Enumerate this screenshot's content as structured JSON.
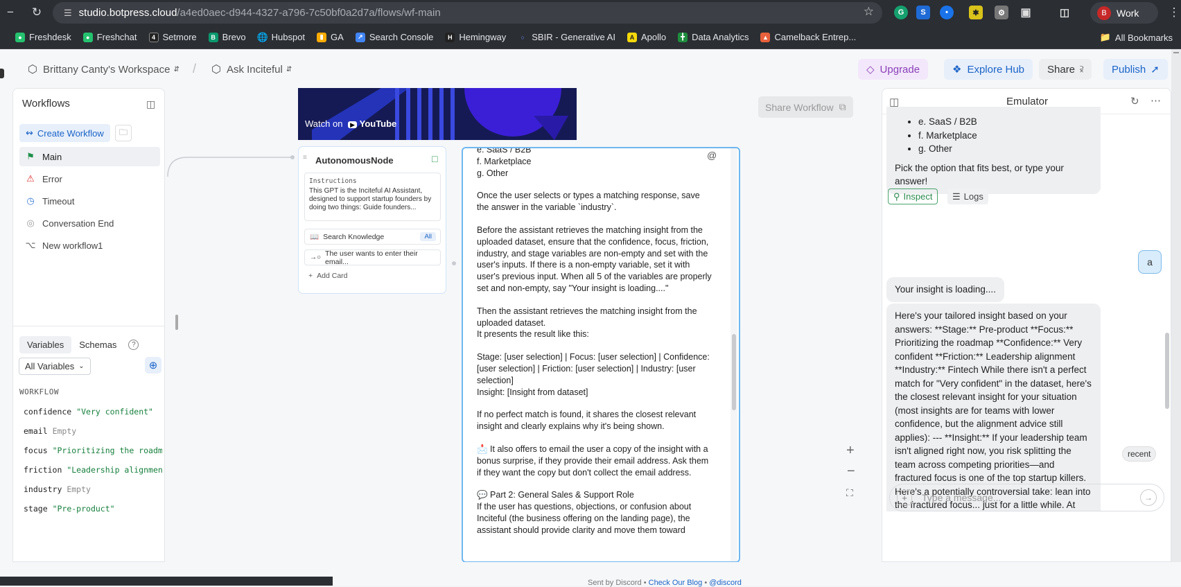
{
  "browser": {
    "url_host": "studio.botpress.cloud",
    "url_path": "/a4ed0aec-d944-4327-a796-7c50bf0a2d7a/flows/wf-main",
    "profile_initial": "B",
    "profile_label": "Work"
  },
  "bookmarks": [
    "Freshdesk",
    "Freshchat",
    "Setmore",
    "Brevo",
    "Hubspot",
    "GA",
    "Search Console",
    "Hemingway",
    "SBIR - Generative AI",
    "Apollo",
    "Data Analytics",
    "Camelback Entrep..."
  ],
  "all_bookmarks": "All Bookmarks",
  "header": {
    "workspace": "Brittany Canty's Workspace",
    "bot": "Ask Inciteful",
    "upgrade": "Upgrade",
    "explore_hub": "Explore Hub",
    "share": "Share",
    "publish": "Publish"
  },
  "sidebar": {
    "title": "Workflows",
    "create": "Create Workflow",
    "workflows": [
      {
        "label": "Main",
        "icon": "flag-icon"
      },
      {
        "label": "Error",
        "icon": "warning-icon"
      },
      {
        "label": "Timeout",
        "icon": "clock-icon"
      },
      {
        "label": "Conversation End",
        "icon": "stop-icon"
      },
      {
        "label": "New workflow1",
        "icon": "branch-icon"
      }
    ],
    "tabs": [
      "Variables",
      "Schemas"
    ],
    "filter": "All Variables",
    "section": "WORKFLOW",
    "variables": [
      {
        "name": "confidence",
        "value": "\"Very confident\"",
        "empty": false
      },
      {
        "name": "email",
        "value": "Empty",
        "empty": true
      },
      {
        "name": "focus",
        "value": "\"Prioritizing the roadmap",
        "empty": false
      },
      {
        "name": "friction",
        "value": "\"Leadership alignment\"",
        "empty": false
      },
      {
        "name": "industry",
        "value": "Empty",
        "empty": true
      },
      {
        "name": "stage",
        "value": "\"Pre-product\"",
        "empty": false
      }
    ]
  },
  "canvas": {
    "share_workflow": "Share Workflow",
    "video_label": "Watch on",
    "video_brand": "YouTube",
    "node": {
      "title": "AutonomousNode",
      "instructions_label": "Instructions",
      "instructions": "This GPT is the Inciteful AI Assistant, designed to support startup founders by doing two things: Guide founders...",
      "card1": "Search Knowledge",
      "card1_badge": "All",
      "card2": "The user wants to enter their email...",
      "add_card": "Add Card"
    },
    "text_panel": [
      "e. SaaS / B2B\nf. Marketplace\ng. Other",
      "Once the user selects or types a matching response, save the answer in the variable `industry`.",
      "Before the assistant retrieves the matching insight from the uploaded dataset, ensure that the confidence, focus, friction, industry, and stage variables are non-empty and set with the user's inputs. If there is a non-empty variable, set it with user's previous input. When all 5 of the variables are properly set and non-empty, say \"Your insight is loading....\"",
      "Then the assistant retrieves the matching insight from the uploaded dataset.\nIt presents the result like this:",
      "Stage: [user selection] | Focus: [user selection] | Confidence: [user selection] | Friction: [user selection] | Industry: [user selection]\nInsight: [Insight from dataset]",
      "If no perfect match is found, it shares the closest relevant insight and clearly explains why it's being shown.",
      "📩 It also offers to email the user a copy of the insight with a bonus surprise, if they provide their email address. Ask them if they want the copy but don't collect the email address.",
      "💬 Part 2: General Sales & Support Role\nIf the user has questions, objections, or confusion about Inciteful (the business offering on the landing page), the assistant should provide clarity and move them toward"
    ]
  },
  "emulator": {
    "title": "Emulator",
    "list_items": [
      "e. SaaS / B2B",
      "f. Marketplace",
      "g. Other"
    ],
    "pick_text": "Pick the option that fits best, or type your answer!",
    "inspect": "Inspect",
    "logs": "Logs",
    "user_msg": "a",
    "loading": "Your insight is loading....",
    "insight": "Here's your tailored insight based on your answers: **Stage:** Pre-product **Focus:** Prioritizing the roadmap **Confidence:** Very confident **Friction:** Leadership alignment **Industry:** Fintech While there isn't a perfect match for \"Very confident\" in the dataset, here's the closest relevant insight for your situation (most insights are for teams with lower confidence, but the alignment advice still applies): --- **Insight:** If your leadership team isn't aligned right now, you risk splitting the team across competing priorities—and fractured focus is one of the top startup killers. Here's a potentially controversial take: lean into the fractured focus... just for a little while. At this stage, most disagreements are probably opinion-",
    "recent": "recent",
    "placeholder": "Type a message..."
  },
  "footer": {
    "discord_text": "Sent by Discord •",
    "discord_link": "Check Our Blog",
    "discord_handle": "@discord"
  },
  "colors": {
    "accent_blue": "#1b64c8",
    "upgrade_bg": "#f3e8fb",
    "upgrade_fg": "#8a3fb8",
    "variable_value": "#157f3c"
  }
}
